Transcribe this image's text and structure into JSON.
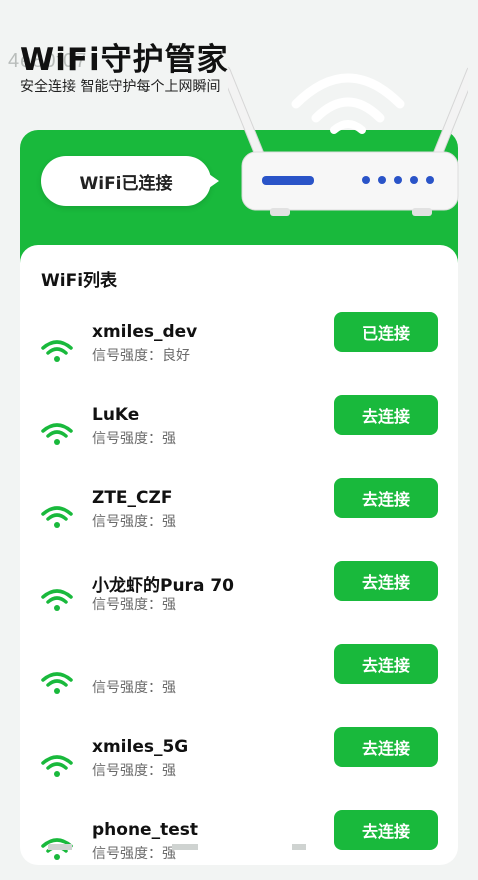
{
  "watermark": "4e80f07",
  "header": {
    "title": "WiFi守护管家",
    "subtitle": "安全连接  智能守护每个上网瞬间"
  },
  "hero": {
    "status_label": "WiFi已连接"
  },
  "list": {
    "title": "WiFi列表",
    "signal_prefix": "信号强度：",
    "networks": [
      {
        "name": "xmiles_dev",
        "signal": "信号强度：良好",
        "action": "已连接"
      },
      {
        "name": "LuKe",
        "signal": "信号强度：强",
        "action": "去连接"
      },
      {
        "name": "ZTE_CZF",
        "signal": "信号强度：强",
        "action": "去连接"
      },
      {
        "name": "小龙虾的Pura 70",
        "signal": "信号强度：强",
        "action": "去连接"
      },
      {
        "name": "",
        "signal": "信号强度：强",
        "action": "去连接"
      },
      {
        "name": "xmiles_5G",
        "signal": "信号强度：强",
        "action": "去连接"
      },
      {
        "name": "phone_test",
        "signal": "信号强度：强",
        "action": "去连接"
      }
    ]
  },
  "colors": {
    "accent": "#19b93c",
    "background": "#f2f4f3"
  },
  "icons": {
    "wifi": "wifi-signal-icon",
    "router": "router-illustration"
  }
}
